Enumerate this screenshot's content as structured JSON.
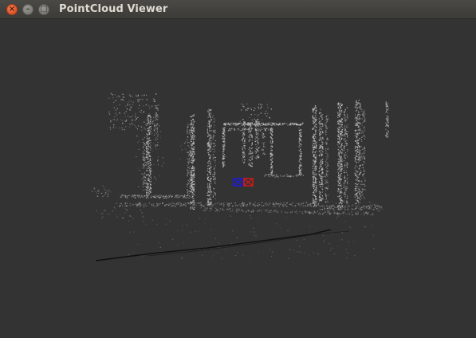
{
  "window": {
    "title": "PointCloud Viewer",
    "close_glyph": "×",
    "minimize_glyph": "–",
    "maximize_glyph": "□"
  },
  "viewport": {
    "background_color": "#333333",
    "point_color": "#c8c8c8",
    "ground_line_color": "#111111",
    "camera_markers": [
      {
        "name": "camera-marker-blue",
        "color": "#1a1adc"
      },
      {
        "name": "camera-marker-red",
        "color": "#d81818"
      }
    ]
  }
}
